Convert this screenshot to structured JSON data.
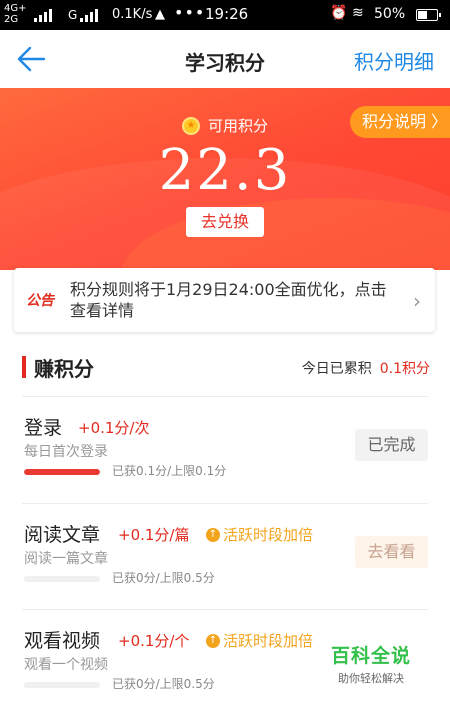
{
  "status_bar": {
    "network_top": "4G+",
    "network_bottom": "2G",
    "carrier_g": "G",
    "speed": "0.1K/s",
    "time": "19:26",
    "battery": "50%",
    "battery_level": 0.5
  },
  "header": {
    "title": "学习积分",
    "detail_link": "积分明细"
  },
  "hero": {
    "available_label": "可用积分",
    "points": "22.3",
    "redeem_button": "去兑换",
    "explain_button": "积分说明 〉"
  },
  "notice": {
    "tag": "公告",
    "text": "积分规则将于1月29日24:00全面优化，点击查看详情"
  },
  "earn": {
    "title": "赚积分",
    "today_label": "今日已累积",
    "today_value": "0.1积分"
  },
  "tasks": [
    {
      "name": "登录",
      "reward": "+0.1分/次",
      "bonus": "",
      "subtitle": "每日首次登录",
      "progress_text": "已获0.1分/上限0.1分",
      "progress": 1.0,
      "button": "已完成"
    },
    {
      "name": "阅读文章",
      "reward": "+0.1分/篇",
      "bonus": "活跃时段加倍",
      "subtitle": "阅读一篇文章",
      "progress_text": "已获0分/上限0.5分",
      "progress": 0.0,
      "button": "去看看"
    },
    {
      "name": "观看视频",
      "reward": "+0.1分/个",
      "bonus": "活跃时段加倍",
      "subtitle": "观看一个视频",
      "progress_text": "已获0分/上限0.5分",
      "progress": 0.0,
      "button": ""
    }
  ],
  "watermark": {
    "title": "百科全说",
    "subtitle": "助你轻松解决"
  },
  "colors": {
    "accent_blue": "#1e88e5",
    "accent_red": "#e22a1e",
    "hero_orange": "#ff5a38",
    "bonus_orange": "#f3a41d"
  }
}
